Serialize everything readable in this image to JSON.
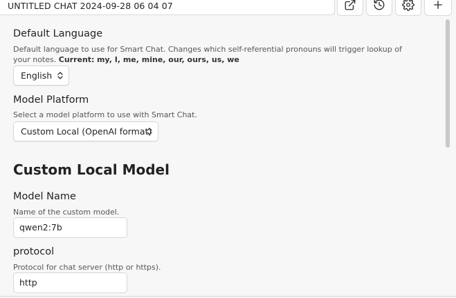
{
  "chat": {
    "title": "UNTITLED CHAT 2024-09-28 06 04 07"
  },
  "toolbar": {
    "icons": [
      "open-external-icon",
      "history-icon",
      "gear-icon",
      "plus-icon"
    ]
  },
  "settings": {
    "language": {
      "title": "Default Language",
      "description": "Default language to use for Smart Chat. Changes which self-referential pronouns will trigger lookup of your notes.",
      "current_label": "Current:",
      "current_value": "my, I, me, mine, our, ours, us, we",
      "selected": "English"
    },
    "platform": {
      "title": "Model Platform",
      "description": "Select a model platform to use with Smart Chat.",
      "selected": "Custom Local (OpenAI format)"
    },
    "custom_heading": "Custom Local Model",
    "model_name": {
      "title": "Model Name",
      "description": "Name of the custom model.",
      "value": "qwen2:7b"
    },
    "protocol": {
      "title": "protocol",
      "description": "Protocol for chat server (http or https).",
      "value": "http"
    }
  }
}
